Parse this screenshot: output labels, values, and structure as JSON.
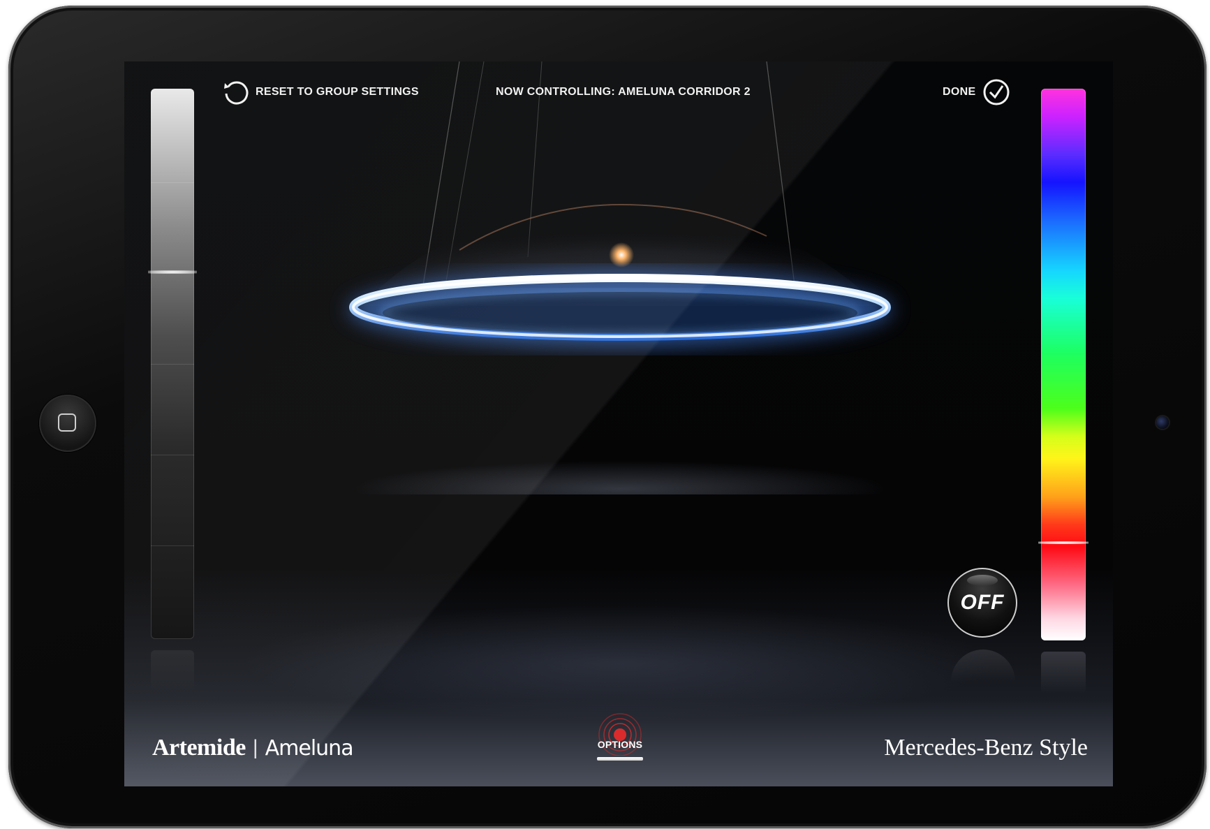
{
  "header": {
    "reset_label": "RESET TO GROUP SETTINGS",
    "now_controlling": "NOW CONTROLLING: AMELUNA CORRIDOR 2",
    "done_label": "DONE"
  },
  "controls": {
    "power_label": "OFF",
    "brightness_level_fraction": 0.67,
    "hue_position_fraction": 0.82
  },
  "footer": {
    "brand": "Artemide",
    "separator": "|",
    "product": "Ameluna",
    "options_label": "OPTIONS",
    "partner": "Mercedes-Benz Style"
  },
  "icons": {
    "reset": "reset-arrow-icon",
    "done": "check-circle-icon",
    "options": "options-radar-icon",
    "home": "home-button-icon"
  },
  "colors": {
    "background": "#050506",
    "text": "#f2f2f2",
    "lamp_glow": "#6fb2ff",
    "options_accent": "#e32b2b"
  }
}
